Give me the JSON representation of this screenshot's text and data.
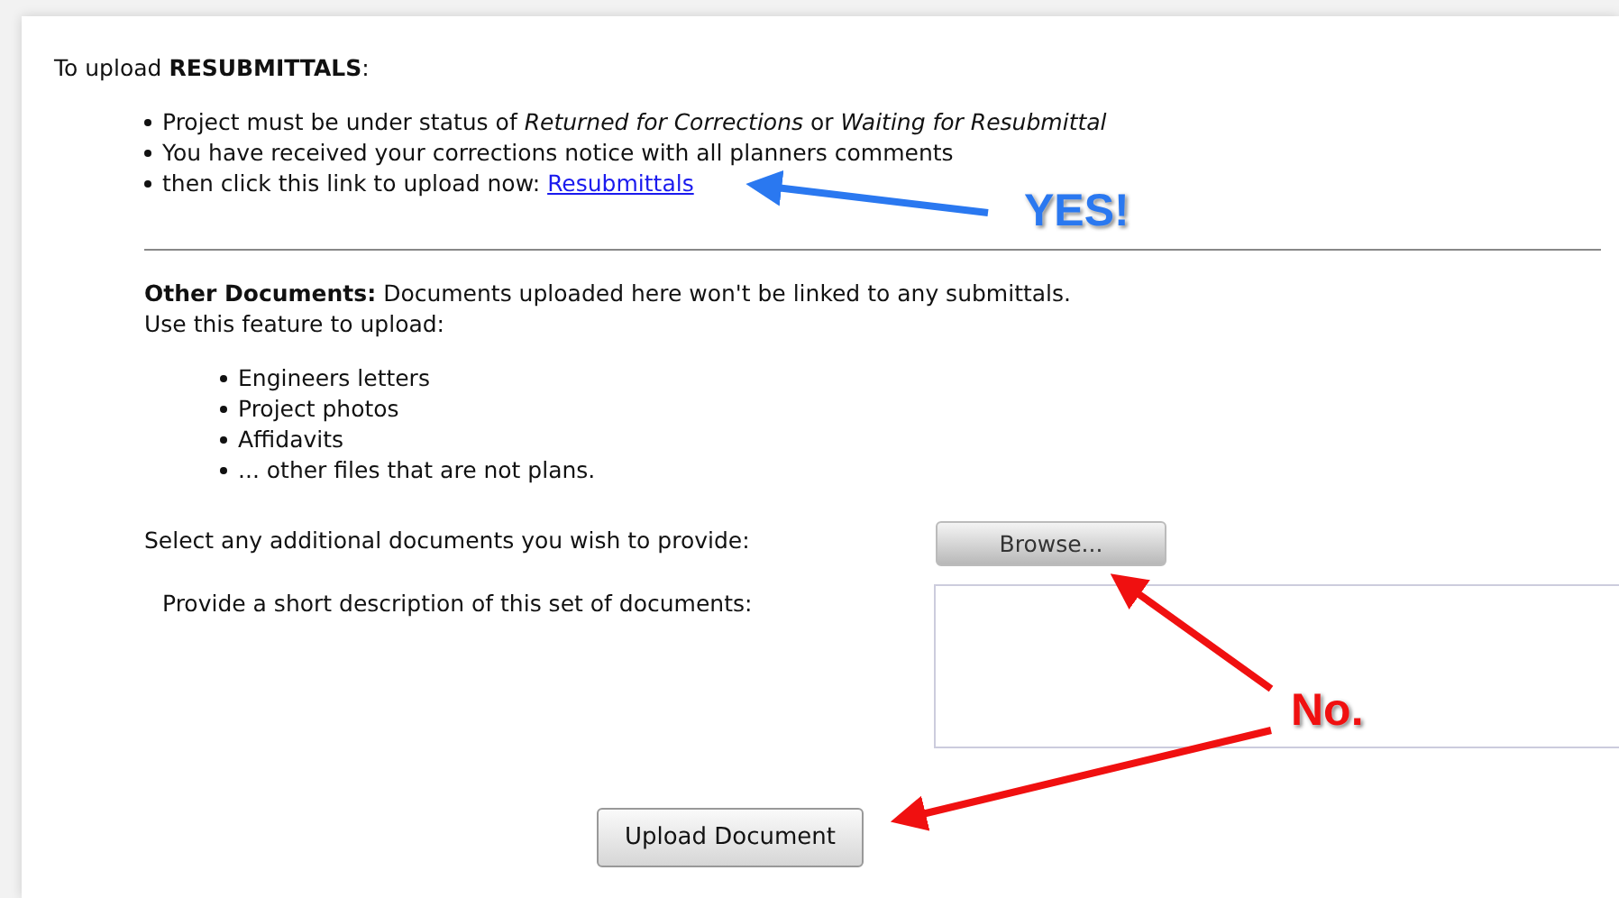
{
  "resubmittals": {
    "heading": "To upload **RESUBMITTALS**:",
    "bullets": [
      {
        "text": "Project must be under status of *Returned for Corrections* or *Waiting for Resubmittal*"
      },
      {
        "text": "You have received your corrections notice with all planners comments"
      },
      {
        "text": "then click this link to upload now:",
        "link": "Resubmittals"
      }
    ]
  },
  "other_documents": {
    "intro": "**Other Documents:** Documents uploaded here won't be linked to any submittals.",
    "intro_2": "Use this feature to upload:",
    "items": [
      "Engineers letters",
      "Project photos",
      "Affidavits",
      "... other files that are not plans."
    ]
  },
  "form": {
    "file_label": "Select any additional documents you wish to provide:",
    "browse_button": "Browse...",
    "description_label": "Provide a short description of this set of documents:",
    "submit_button": "Upload Document"
  },
  "annotations": [
    {
      "text": "YES!",
      "color": "#2a78f0"
    },
    {
      "text": "No.",
      "color": "#f01010"
    }
  ]
}
